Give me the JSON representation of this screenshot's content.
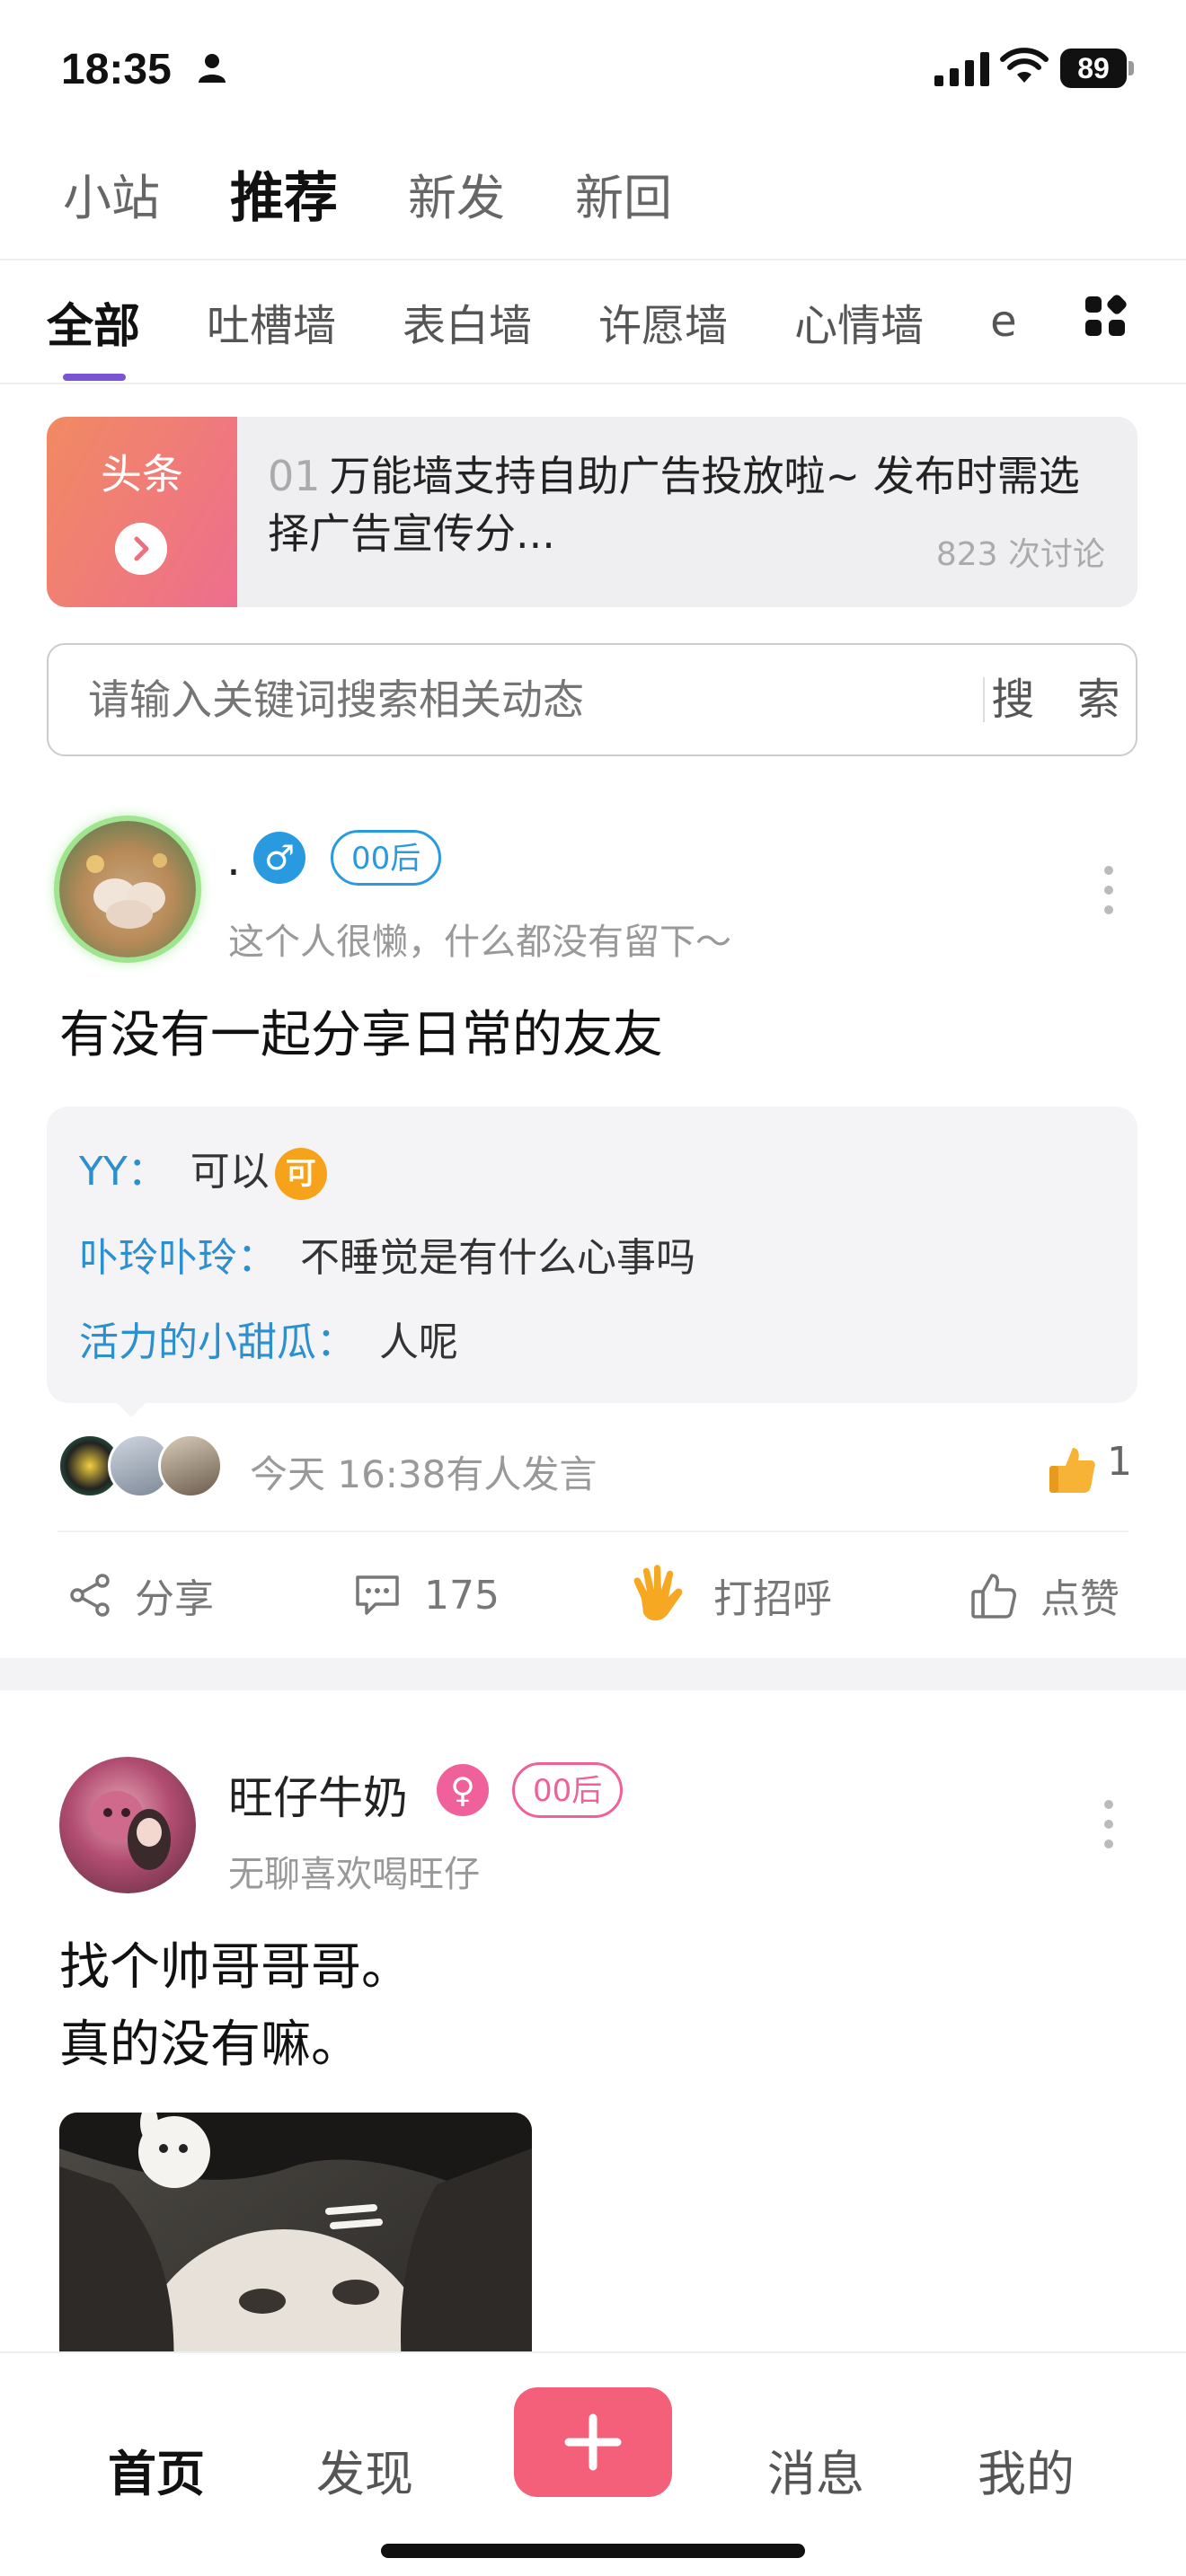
{
  "status_bar": {
    "time": "18:35",
    "battery": "89"
  },
  "top_tabs": [
    {
      "label": "小站"
    },
    {
      "label": "推荐"
    },
    {
      "label": "新发"
    },
    {
      "label": "新回"
    }
  ],
  "category_tabs": [
    {
      "label": "全部"
    },
    {
      "label": "吐槽墙"
    },
    {
      "label": "表白墙"
    },
    {
      "label": "许愿墙"
    },
    {
      "label": "心情墙"
    },
    {
      "label": "e"
    }
  ],
  "headline": {
    "badge": "头条",
    "number": "01",
    "text": "万能墙支持自助广告投放啦~ 发布时需选择广告宣传分...",
    "discussion_count": "823 次讨论"
  },
  "search": {
    "placeholder": "请输入关键词搜索相关动态",
    "button": "搜 索"
  },
  "posts": [
    {
      "username": ".",
      "gender_symbol": "♂",
      "age_tag": "00后",
      "bio": "这个人很懒，什么都没有留下～",
      "content": "有没有一起分享日常的友友",
      "replies": [
        {
          "author": "YY：",
          "text": "可以",
          "badge": "可"
        },
        {
          "author": "卟玲卟玲：",
          "text": "不睡觉是有什么心事吗"
        },
        {
          "author": "活力的小甜瓜：",
          "text": "人呢"
        }
      ],
      "activity": "今天 16:38有人发言",
      "likes": "1",
      "actions": {
        "share": "分享",
        "comments": "175",
        "greet": "打招呼",
        "like": "点赞"
      },
      "colors": {
        "gender": "#2a9ae0",
        "tag": "#2a9ae0"
      }
    },
    {
      "username": "旺仔牛奶",
      "gender_symbol": "♀",
      "age_tag": "00后",
      "bio": "无聊喜欢喝旺仔",
      "content_lines": [
        "找个帅哥哥哥。",
        "真的没有嘛。"
      ],
      "colors": {
        "gender": "#f0609a",
        "tag": "#f0609a"
      }
    }
  ],
  "bottom_nav": [
    {
      "label": "首页"
    },
    {
      "label": "发现"
    },
    {
      "label": "消息"
    },
    {
      "label": "我的"
    }
  ],
  "colors": {
    "accent": "#7b54d6",
    "publish": "#f4607a",
    "link": "#2c8fd0"
  }
}
